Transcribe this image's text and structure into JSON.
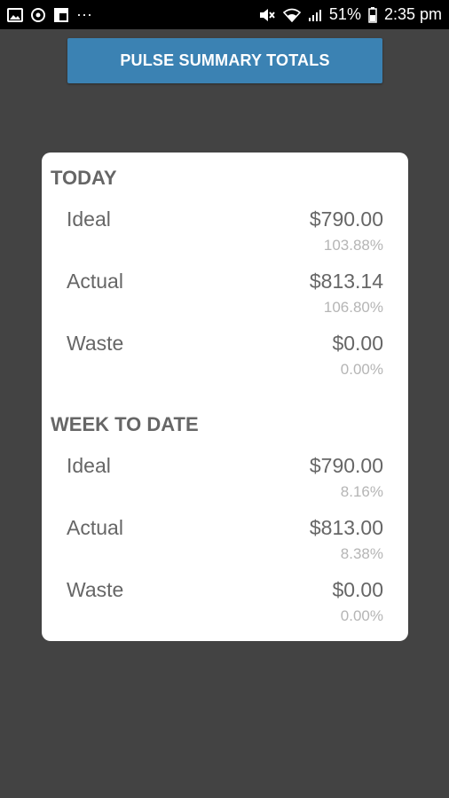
{
  "status_bar": {
    "left_icons": [
      "image-icon",
      "sync-icon",
      "flipboard-icon",
      "more-dots-icon"
    ],
    "more": "···",
    "battery": "51%",
    "time": "2:35 pm"
  },
  "header": {
    "button_label": "PULSE SUMMARY TOTALS",
    "button_color": "#3b82b3"
  },
  "sections": [
    {
      "title": "TODAY",
      "rows": [
        {
          "label": "Ideal",
          "amount": "$790.00",
          "percent": "103.88%"
        },
        {
          "label": "Actual",
          "amount": "$813.14",
          "percent": "106.80%"
        },
        {
          "label": "Waste",
          "amount": "$0.00",
          "percent": "0.00%"
        }
      ]
    },
    {
      "title": "WEEK TO DATE",
      "rows": [
        {
          "label": "Ideal",
          "amount": "$790.00",
          "percent": "8.16%"
        },
        {
          "label": "Actual",
          "amount": "$813.00",
          "percent": "8.38%"
        },
        {
          "label": "Waste",
          "amount": "$0.00",
          "percent": "0.00%"
        }
      ]
    }
  ]
}
